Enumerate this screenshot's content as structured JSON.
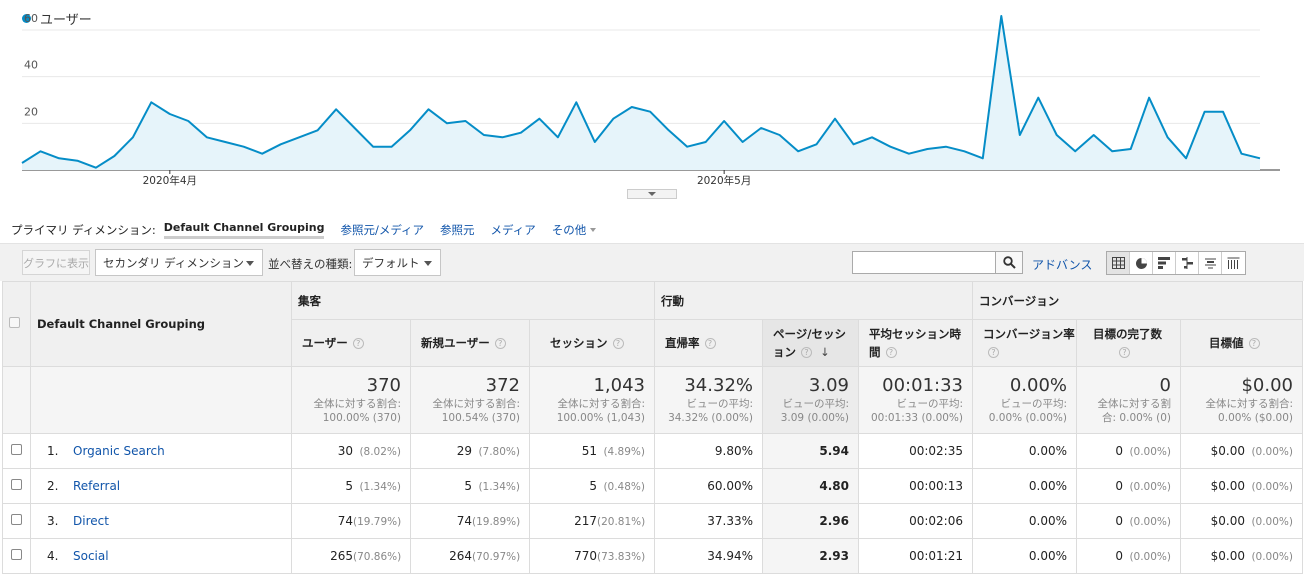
{
  "legend": {
    "label": "ユーザー",
    "color": "#058dc7"
  },
  "chart_data": {
    "type": "area",
    "series": [
      {
        "name": "ユーザー",
        "values": [
          3,
          8,
          5,
          4,
          1,
          6,
          14,
          29,
          24,
          21,
          14,
          12,
          10,
          7,
          11,
          14,
          17,
          26,
          18,
          10,
          10,
          17,
          26,
          20,
          21,
          15,
          14,
          16,
          22,
          14,
          29,
          12,
          22,
          27,
          25,
          17,
          10,
          12,
          21,
          12,
          18,
          15,
          8,
          11,
          22,
          11,
          14,
          10,
          7,
          9,
          10,
          8,
          5,
          66,
          15,
          31,
          15,
          8,
          15,
          8,
          9,
          31,
          14,
          5,
          25,
          25,
          7,
          5
        ]
      }
    ],
    "x_tick_labels": [
      "2020年4月",
      "2020年5月"
    ],
    "y_ticks": [
      20,
      40,
      60
    ],
    "ylim": [
      0,
      60
    ],
    "grid": true
  },
  "dimension_bar": {
    "label": "プライマリ ディメンション:",
    "active": "Default Channel Grouping",
    "links": [
      "参照元/メディア",
      "参照元",
      "メディア"
    ],
    "more": "その他"
  },
  "toolbar": {
    "graph_button": "グラフに表示",
    "secondary_dimension": "セカンダリ ディメンション",
    "sort_label": "並べ替えの種類:",
    "sort_value": "デフォルト",
    "search_placeholder": "",
    "advanced": "アドバンス"
  },
  "table": {
    "dimension_header": "Default Channel Grouping",
    "groups": [
      "集客",
      "行動",
      "コンバージョン"
    ],
    "columns": [
      "ユーザー",
      "新規ユーザー",
      "セッション",
      "直帰率",
      "ページ/セッション",
      "平均セッション時間",
      "コンバージョン率",
      "目標の完了数",
      "目標値"
    ],
    "totals": [
      {
        "value": "370",
        "sub1": "全体に対する割合:",
        "sub2": "100.00% (370)"
      },
      {
        "value": "372",
        "sub1": "全体に対する割合:",
        "sub2": "100.54% (370)"
      },
      {
        "value": "1,043",
        "sub1": "全体に対する割合:",
        "sub2": "100.00% (1,043)"
      },
      {
        "value": "34.32%",
        "sub1": "ビューの平均:",
        "sub2": "34.32% (0.00%)"
      },
      {
        "value": "3.09",
        "sub1": "ビューの平均:",
        "sub2": "3.09 (0.00%)"
      },
      {
        "value": "00:01:33",
        "sub1": "ビューの平均:",
        "sub2": "00:01:33 (0.00%)"
      },
      {
        "value": "0.00%",
        "sub1": "ビューの平均:",
        "sub2": "0.00% (0.00%)"
      },
      {
        "value": "0",
        "sub1": "全体に対する割",
        "sub2": "合: 0.00% (0)"
      },
      {
        "value": "$0.00",
        "sub1": "全体に対する割合:",
        "sub2": "0.00% ($0.00)"
      }
    ],
    "rows": [
      {
        "index": "1.",
        "name": "Organic Search",
        "users": "30",
        "users_pct": "(8.02%)",
        "new_users": "29",
        "new_users_pct": "(7.80%)",
        "sessions": "51",
        "sessions_pct": "(4.89%)",
        "bounce": "9.80%",
        "pages": "5.94",
        "duration": "00:02:35",
        "conv": "0.00%",
        "goals": "0",
        "goals_pct": "(0.00%)",
        "value": "$0.00",
        "value_pct": "(0.00%)"
      },
      {
        "index": "2.",
        "name": "Referral",
        "users": "5",
        "users_pct": "(1.34%)",
        "new_users": "5",
        "new_users_pct": "(1.34%)",
        "sessions": "5",
        "sessions_pct": "(0.48%)",
        "bounce": "60.00%",
        "pages": "4.80",
        "duration": "00:00:13",
        "conv": "0.00%",
        "goals": "0",
        "goals_pct": "(0.00%)",
        "value": "$0.00",
        "value_pct": "(0.00%)"
      },
      {
        "index": "3.",
        "name": "Direct",
        "users": "74",
        "users_pct": "(19.79%)",
        "new_users": "74",
        "new_users_pct": "(19.89%)",
        "sessions": "217",
        "sessions_pct": "(20.81%)",
        "bounce": "37.33%",
        "pages": "2.96",
        "duration": "00:02:06",
        "conv": "0.00%",
        "goals": "0",
        "goals_pct": "(0.00%)",
        "value": "$0.00",
        "value_pct": "(0.00%)"
      },
      {
        "index": "4.",
        "name": "Social",
        "users": "265",
        "users_pct": "(70.86%)",
        "new_users": "264",
        "new_users_pct": "(70.97%)",
        "sessions": "770",
        "sessions_pct": "(73.83%)",
        "bounce": "34.94%",
        "pages": "2.93",
        "duration": "00:01:21",
        "conv": "0.00%",
        "goals": "0",
        "goals_pct": "(0.00%)",
        "value": "$0.00",
        "value_pct": "(0.00%)"
      }
    ]
  }
}
